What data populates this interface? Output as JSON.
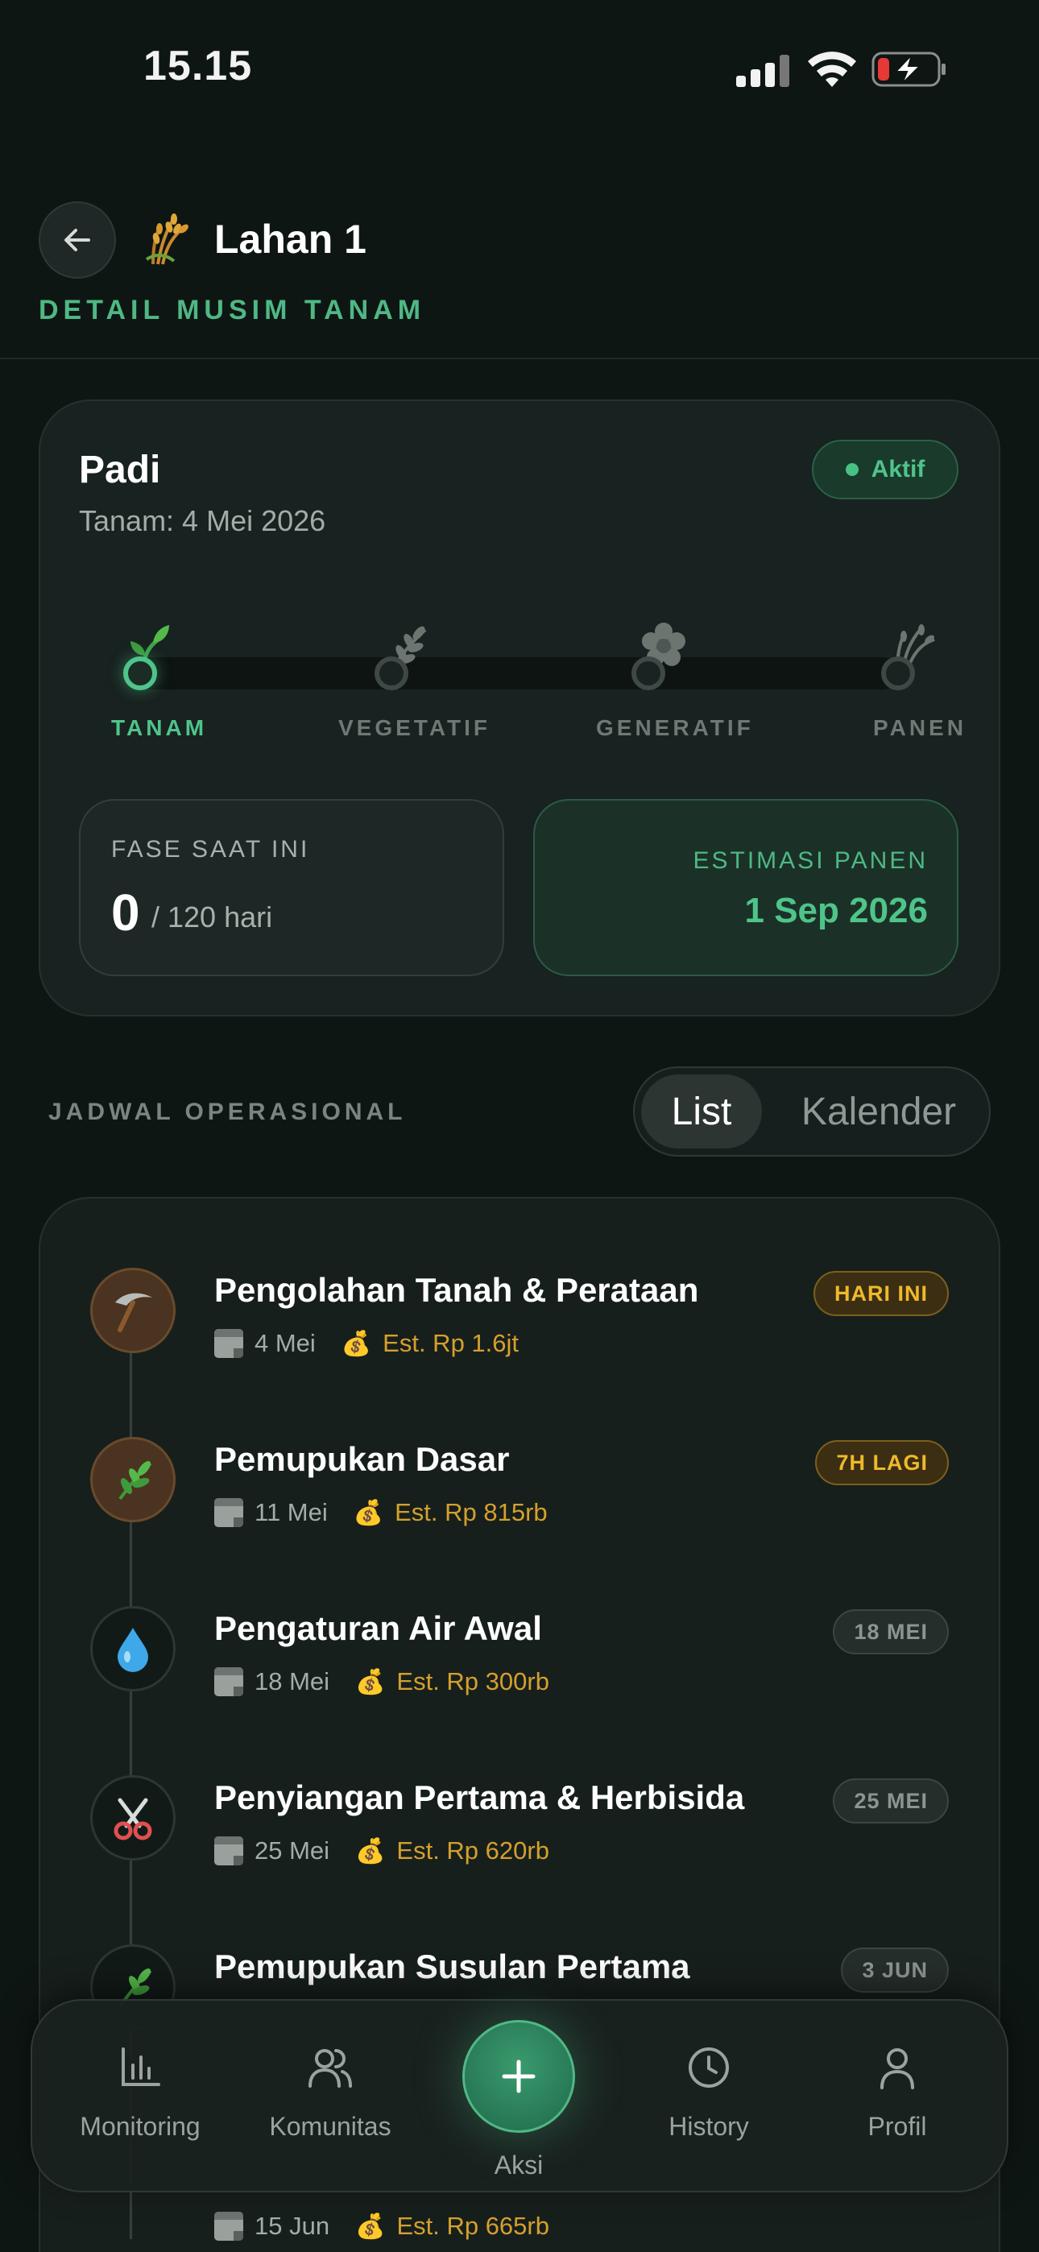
{
  "status_bar": {
    "time": "15.15"
  },
  "header": {
    "title": "Lahan 1",
    "subtitle": "DETAIL MUSIM TANAM"
  },
  "season": {
    "crop": "Padi",
    "plant_date": "Tanam: 4 Mei 2026",
    "status": "Aktif",
    "stages": [
      {
        "label": "TANAM",
        "active": true,
        "icon": "sprout-icon"
      },
      {
        "label": "VEGETATIF",
        "active": false,
        "icon": "leaves-icon"
      },
      {
        "label": "GENERATIF",
        "active": false,
        "icon": "flower-icon"
      },
      {
        "label": "PANEN",
        "active": false,
        "icon": "rice-sheaf-icon"
      }
    ],
    "phase": {
      "label": "FASE SAAT INI",
      "value": "0",
      "total": "/ 120 hari"
    },
    "harvest": {
      "label": "ESTIMASI PANEN",
      "value": "1 Sep 2026"
    }
  },
  "schedule": {
    "title": "JADWAL OPERASIONAL",
    "view_list": "List",
    "view_calendar": "Kalender",
    "tasks": [
      {
        "title": "Pengolahan Tanah & Perataan",
        "date": "4 Mei",
        "cost": "Est. Rp 1.6jt",
        "chip": "HARI INI",
        "icon": "pickaxe-icon"
      },
      {
        "title": "Pemupukan Dasar",
        "date": "11 Mei",
        "cost": "Est. Rp 815rb",
        "chip": "7H LAGI",
        "icon": "herb-icon"
      },
      {
        "title": "Pengaturan Air Awal",
        "date": "18 Mei",
        "cost": "Est. Rp 300rb",
        "chip": "18 MEI",
        "icon": "water-drop-icon"
      },
      {
        "title": "Penyiangan Pertama & Herbisida",
        "date": "25 Mei",
        "cost": "Est. Rp 620rb",
        "chip": "25 MEI",
        "icon": "scissors-icon"
      },
      {
        "title": "Pemupukan Susulan Pertama",
        "date": "",
        "cost": "",
        "chip": "3 JUN",
        "icon": "herb-icon"
      },
      {
        "title": "",
        "date": "15 Jun",
        "cost": "Est. Rp 665rb",
        "chip": "",
        "icon": ""
      }
    ]
  },
  "nav": {
    "monitoring": "Monitoring",
    "komunitas": "Komunitas",
    "aksi": "Aksi",
    "history": "History",
    "profil": "Profil"
  },
  "colors": {
    "accent": "#4fc48a",
    "warning": "#f0b92c",
    "background": "#0e1614"
  }
}
